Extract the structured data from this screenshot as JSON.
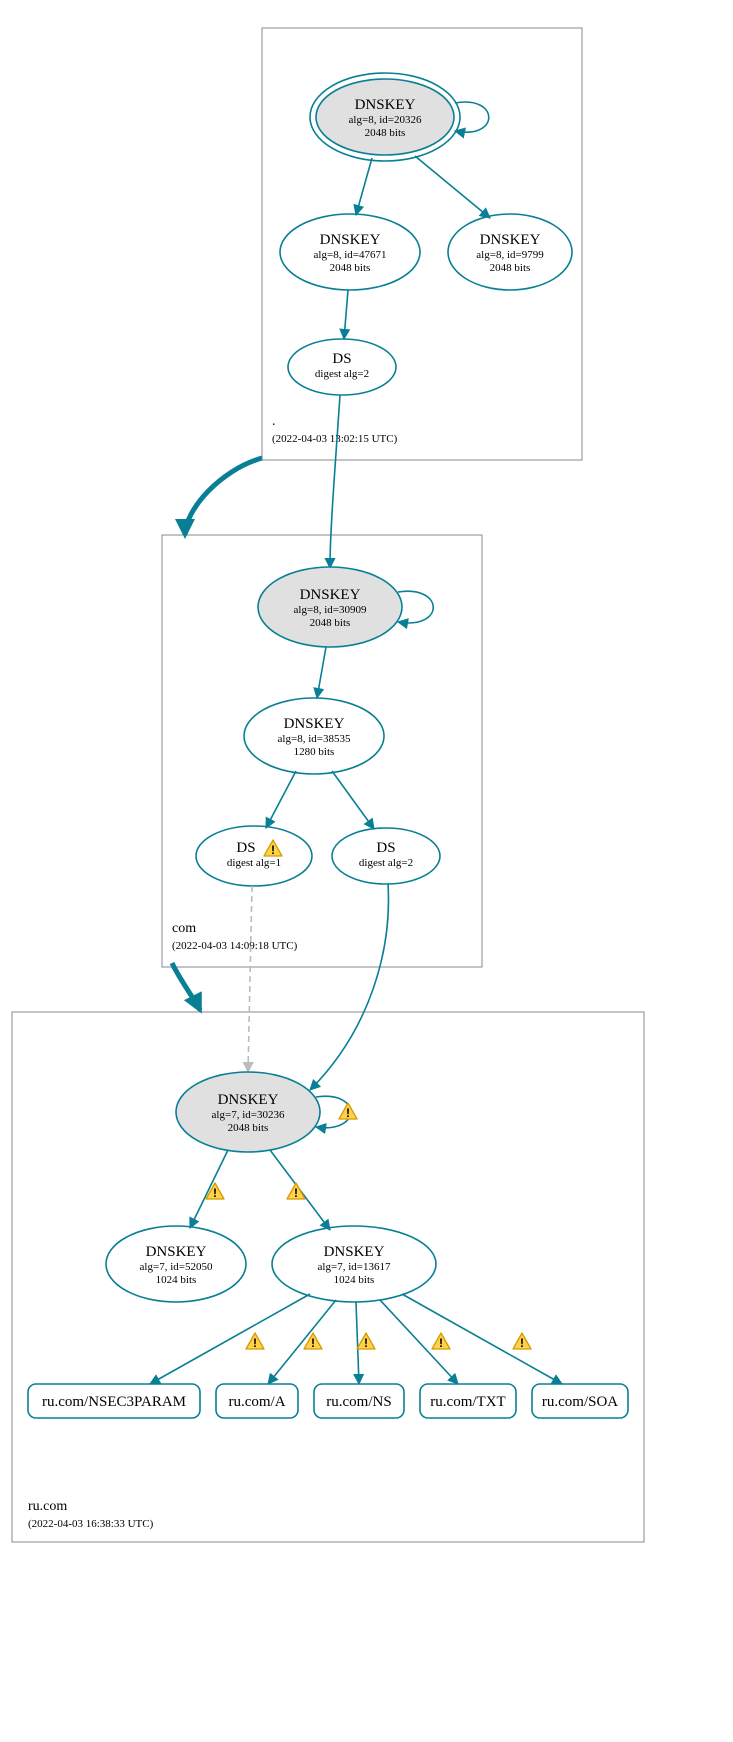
{
  "zones": {
    "root": {
      "label": ".",
      "timestamp": "(2022-04-03 13:02:15 UTC)"
    },
    "com": {
      "label": "com",
      "timestamp": "(2022-04-03 14:09:18 UTC)"
    },
    "ru": {
      "label": "ru.com",
      "timestamp": "(2022-04-03 16:38:33 UTC)"
    }
  },
  "nodes": {
    "root_ksk": {
      "title": "DNSKEY",
      "line2": "alg=8, id=20326",
      "line3": "2048 bits"
    },
    "root_zsk": {
      "title": "DNSKEY",
      "line2": "alg=8, id=47671",
      "line3": "2048 bits"
    },
    "root_k3": {
      "title": "DNSKEY",
      "line2": "alg=8, id=9799",
      "line3": "2048 bits"
    },
    "root_ds": {
      "title": "DS",
      "line2": "digest alg=2"
    },
    "com_ksk": {
      "title": "DNSKEY",
      "line2": "alg=8, id=30909",
      "line3": "2048 bits"
    },
    "com_zsk": {
      "title": "DNSKEY",
      "line2": "alg=8, id=38535",
      "line3": "1280 bits"
    },
    "com_ds1": {
      "title": "DS",
      "line2": "digest alg=1"
    },
    "com_ds2": {
      "title": "DS",
      "line2": "digest alg=2"
    },
    "ru_ksk": {
      "title": "DNSKEY",
      "line2": "alg=7, id=30236",
      "line3": "2048 bits"
    },
    "ru_zsk1": {
      "title": "DNSKEY",
      "line2": "alg=7, id=52050",
      "line3": "1024 bits"
    },
    "ru_zsk2": {
      "title": "DNSKEY",
      "line2": "alg=7, id=13617",
      "line3": "1024 bits"
    },
    "rr_nsec3": {
      "title": "ru.com/NSEC3PARAM"
    },
    "rr_a": {
      "title": "ru.com/A"
    },
    "rr_ns": {
      "title": "ru.com/NS"
    },
    "rr_txt": {
      "title": "ru.com/TXT"
    },
    "rr_soa": {
      "title": "ru.com/SOA"
    }
  }
}
